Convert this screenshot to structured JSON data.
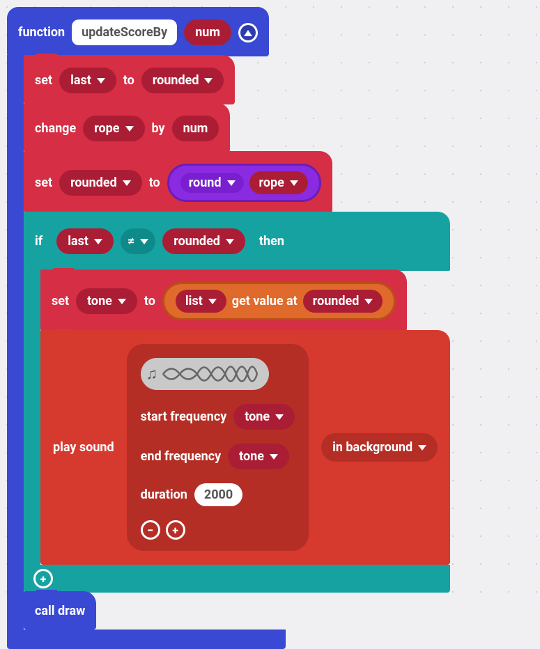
{
  "hat": {
    "function_kw": "function",
    "name": "updateScoreBy",
    "param": "num"
  },
  "b1": {
    "set_kw": "set",
    "var": "last",
    "to_kw": "to",
    "val": "rounded"
  },
  "b2": {
    "change_kw": "change",
    "var": "rope",
    "by_kw": "by",
    "val": "num"
  },
  "b3": {
    "set_kw": "set",
    "var": "rounded",
    "to_kw": "to",
    "op": "round",
    "arg": "rope"
  },
  "cif": {
    "if_kw": "if",
    "then_kw": "then",
    "left": "last",
    "op": "≠",
    "right": "rounded"
  },
  "b4": {
    "set_kw": "set",
    "var": "tone",
    "to_kw": "to",
    "list": "list",
    "getvalue": "get value at",
    "idx": "rounded"
  },
  "b5": {
    "play_kw": "play sound",
    "startf": "start frequency",
    "startv": "tone",
    "endf": "end frequency",
    "endv": "tone",
    "dur_kw": "duration",
    "dur_v": "2000",
    "bg": "in background"
  },
  "b6": {
    "call": "call draw"
  }
}
